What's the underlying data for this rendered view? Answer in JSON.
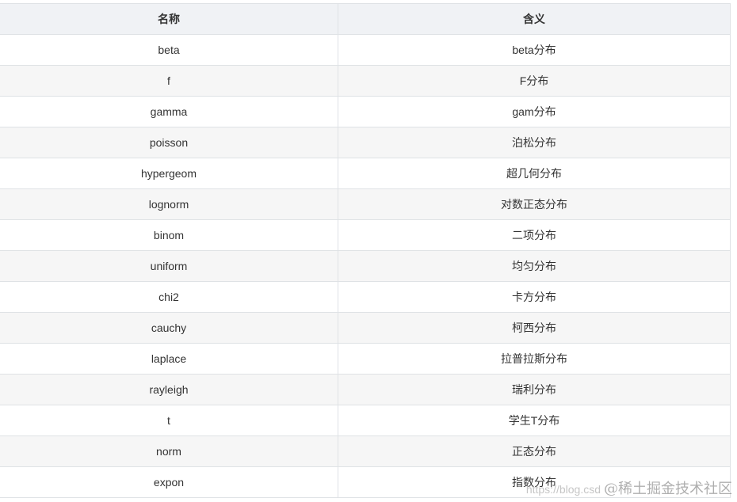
{
  "table": {
    "headers": [
      "名称",
      "含义"
    ],
    "rows": [
      [
        "beta",
        "beta分布"
      ],
      [
        "f",
        "F分布"
      ],
      [
        "gamma",
        "gam分布"
      ],
      [
        "poisson",
        "泊松分布"
      ],
      [
        "hypergeom",
        "超几何分布"
      ],
      [
        "lognorm",
        "对数正态分布"
      ],
      [
        "binom",
        "二项分布"
      ],
      [
        "uniform",
        "均匀分布"
      ],
      [
        "chi2",
        "卡方分布"
      ],
      [
        "cauchy",
        "柯西分布"
      ],
      [
        "laplace",
        "拉普拉斯分布"
      ],
      [
        "rayleigh",
        "瑞利分布"
      ],
      [
        "t",
        "学生T分布"
      ],
      [
        "norm",
        "正态分布"
      ],
      [
        "expon",
        "指数分布"
      ]
    ]
  },
  "watermark": {
    "url_fragment": "https://blog.csd",
    "brand": "@稀土掘金技术社区"
  }
}
